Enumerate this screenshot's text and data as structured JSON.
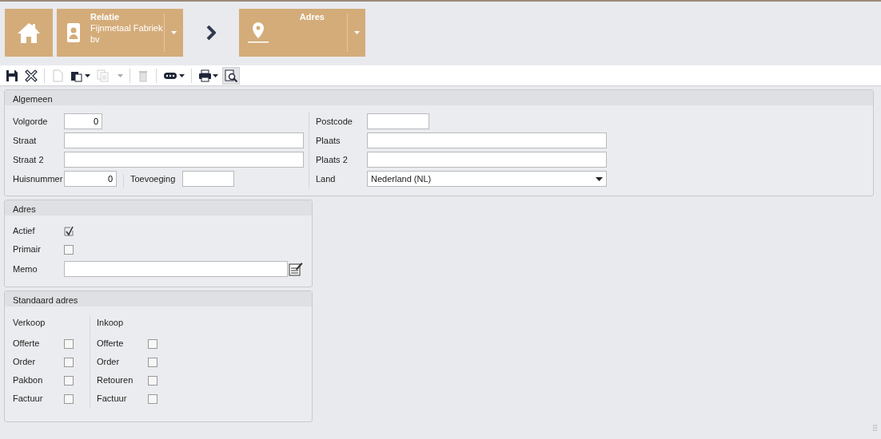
{
  "breadcrumb": {
    "items": [
      {
        "kind": "home"
      },
      {
        "kind": "relation",
        "title": "Relatie",
        "subtitle": "Fijnmetaal Fabriek bv"
      },
      {
        "kind": "separator"
      },
      {
        "kind": "address",
        "title": "Adres"
      }
    ]
  },
  "toolbar": [
    {
      "kind": "save",
      "disabled": false,
      "dropdown": false,
      "pressed": false
    },
    {
      "kind": "close",
      "disabled": false,
      "dropdown": false,
      "pressed": false
    },
    {
      "kind": "divider"
    },
    {
      "kind": "new",
      "disabled": true,
      "dropdown": false,
      "pressed": false
    },
    {
      "kind": "paste",
      "disabled": false,
      "dropdown": true,
      "pressed": false
    },
    {
      "kind": "copy",
      "disabled": true,
      "dropdown": true,
      "pressed": false
    },
    {
      "kind": "divider"
    },
    {
      "kind": "delete",
      "disabled": true,
      "dropdown": false,
      "pressed": false
    },
    {
      "kind": "divider"
    },
    {
      "kind": "more",
      "disabled": false,
      "dropdown": true,
      "pressed": false
    },
    {
      "kind": "divider"
    },
    {
      "kind": "print",
      "disabled": false,
      "dropdown": true,
      "pressed": false
    },
    {
      "kind": "preview",
      "disabled": false,
      "dropdown": false,
      "pressed": true
    }
  ],
  "general": {
    "title": "Algemeen",
    "left": [
      {
        "label": "Volgorde",
        "value": "0",
        "kind": "number"
      },
      {
        "label": "Straat",
        "kind": "text"
      },
      {
        "label": "Straat 2",
        "kind": "text"
      },
      {
        "label": "Huisnummer",
        "value": "0",
        "kind": "number",
        "extra_label": "Toevoeging"
      }
    ],
    "right": [
      {
        "label": "Postcode",
        "kind": "short"
      },
      {
        "label": "Plaats",
        "kind": "text"
      },
      {
        "label": "Plaats 2",
        "kind": "text"
      },
      {
        "label": "Land",
        "value": "Nederland (NL)",
        "kind": "select"
      }
    ]
  },
  "address": {
    "title": "Adres",
    "rows": [
      {
        "label": "Actief",
        "kind": "checkbox",
        "checked": true
      },
      {
        "label": "Primair",
        "kind": "checkbox",
        "checked": false
      },
      {
        "label": "Memo",
        "kind": "memo"
      }
    ]
  },
  "default_address": {
    "title": "Standaard adres",
    "groups": [
      {
        "title": "Verkoop",
        "items": [
          {
            "label": "Offerte",
            "checked": false
          },
          {
            "label": "Order",
            "checked": false
          },
          {
            "label": "Pakbon",
            "checked": false
          },
          {
            "label": "Factuur",
            "checked": false
          }
        ]
      },
      {
        "title": "Inkoop",
        "items": [
          {
            "label": "Offerte",
            "checked": false
          },
          {
            "label": "Order",
            "checked": false
          },
          {
            "label": "Retouren",
            "checked": false
          },
          {
            "label": "Factuur",
            "checked": false
          }
        ]
      }
    ]
  }
}
